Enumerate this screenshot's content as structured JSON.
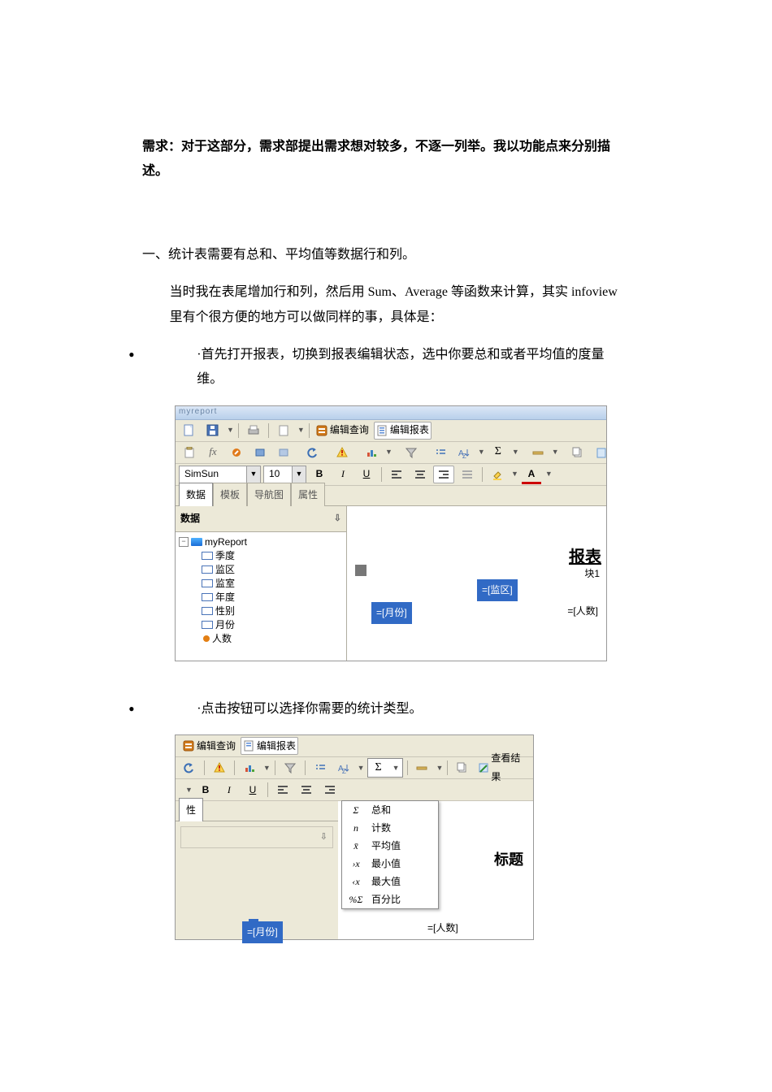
{
  "text": {
    "req_line": "需求：对于这部分，需求部提出需求想对较多，不逐一列举。我以功能点来分别描述。",
    "sec1_title": "一、统计表需要有总和、平均值等数据行和列。",
    "sec1_p1": "当时我在表尾增加行和列，然后用 Sum、Average 等函数来计算，其实 infoview 里有个很方便的地方可以做同样的事，具体是：",
    "sec1_b1": "·首先打开报表，切换到报表编辑状态，选中你要总和或者平均值的度量维。",
    "sec1_b2": "·点击按钮可以选择你需要的统计类型。"
  },
  "shot1": {
    "titlebar": "myreport",
    "btn_edit_query": "编辑查询",
    "btn_edit_report": "编辑报表",
    "font_name": "SimSun",
    "font_size": "10",
    "tabs": {
      "data": "数据",
      "template": "模板",
      "nav": "导航图",
      "props": "属性"
    },
    "side_header": "数据",
    "tree_root": "myReport",
    "tree_items": [
      "季度",
      "监区",
      "监室",
      "年度",
      "性别",
      "月份",
      "人数"
    ],
    "canvas_big": "报表",
    "canvas_blk": "块1",
    "field_jq": "=[监区]",
    "field_yf": "=[月份]",
    "field_rs": "=[人数]"
  },
  "shot2": {
    "btn_edit_query": "编辑查询",
    "btn_edit_report": "编辑报表",
    "btn_view_result": "查看结果",
    "tab_left_char": "性",
    "menu": {
      "sum": {
        "sym": "Σ",
        "label": "总和"
      },
      "count": {
        "sym": "n",
        "label": "计数"
      },
      "avg": {
        "sym": "x̄",
        "label": "平均值"
      },
      "min": {
        "sym": "›x",
        "label": "最小值"
      },
      "max": {
        "sym": "‹x",
        "label": "最大值"
      },
      "pct": {
        "sym": "%Σ",
        "label": "百分比"
      }
    },
    "rt_title": "标题",
    "field_yf": "=[月份]",
    "field_rs": "=[人数]"
  },
  "icons": {
    "sigma": "Σ"
  }
}
